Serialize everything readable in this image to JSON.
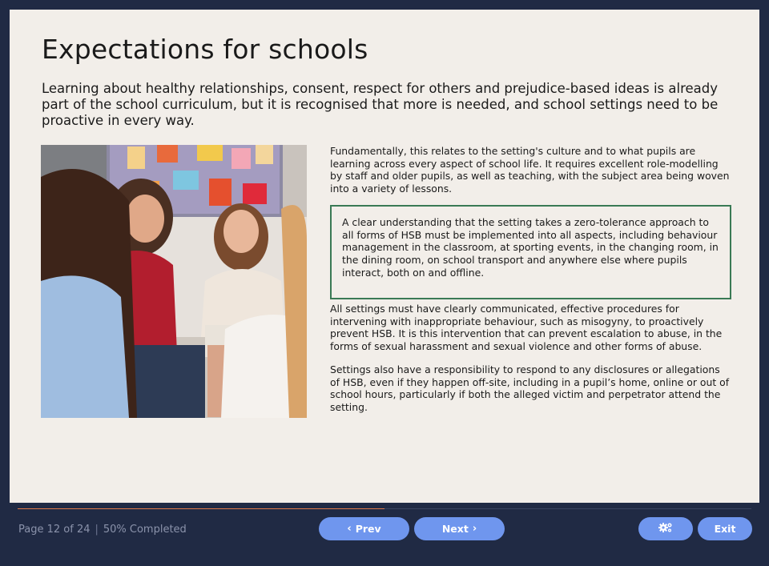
{
  "slide": {
    "title": "Expectations for schools",
    "intro": "Learning about healthy relationships, consent, respect for others and prejudice-based ideas is already part of the school curriculum, but it is recognised that more is needed, and school settings need to be proactive in every way.",
    "paragraph_1": "Fundamentally, this relates to the setting's culture and to what pupils are learning across every aspect of school life. It requires excellent role-modelling by staff and older pupils, as well as teaching, with the subject area being woven into a variety of lessons.",
    "callout": "A clear understanding that the setting takes a zero-tolerance approach to all forms of HSB must be implemented into all aspects, including behaviour management in the classroom, at sporting events, in the changing room, in the dining room, on school transport and anywhere else where pupils interact, both on and offline.",
    "paragraph_3": "All settings must have clearly communicated, effective procedures for intervening with inappropriate behaviour, such as misogyny, to proactively prevent HSB. It is this intervention that can prevent escalation to abuse, in the forms of sexual harassment and sexual violence and other forms of abuse.",
    "paragraph_4": "Settings also have a responsibility to respond to any disclosures or allegations of HSB, even if they happen off-site, including in a pupil’s home, online or out of school hours, particularly if both the alleged victim and perpetrator attend the setting."
  },
  "footer": {
    "page_text": "Page 12 of 24",
    "completed_text": "50% Completed",
    "progress_fraction": 0.5,
    "prev_label": "Prev",
    "next_label": "Next",
    "exit_label": "Exit",
    "settings_icon": "gears-icon"
  },
  "colors": {
    "background": "#202a44",
    "slide": "#f2eee9",
    "button": "#6f96ee",
    "callout_border": "#3a7a55",
    "progress": "#e07a4a"
  }
}
